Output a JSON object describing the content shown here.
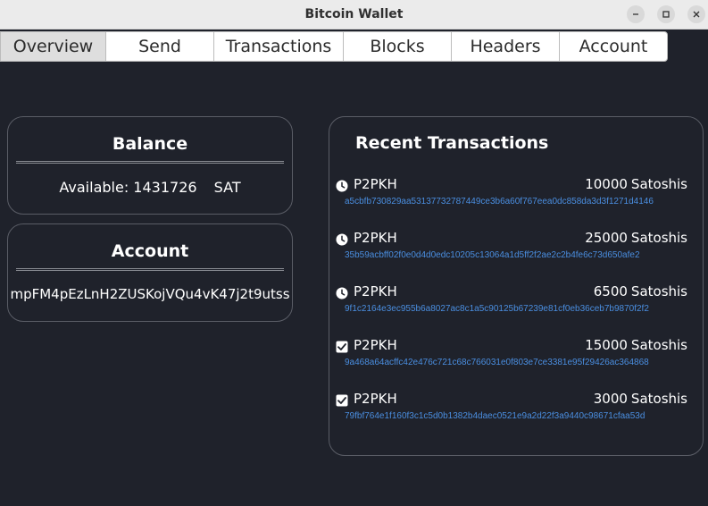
{
  "window": {
    "title": "Bitcoin Wallet"
  },
  "tabs": [
    {
      "label": "Overview",
      "active": true
    },
    {
      "label": "Send"
    },
    {
      "label": "Transactions"
    },
    {
      "label": "Blocks"
    },
    {
      "label": "Headers"
    },
    {
      "label": "Account"
    }
  ],
  "balance": {
    "title": "Balance",
    "available_label": "Available:",
    "amount": "1431726",
    "unit": "SAT"
  },
  "account": {
    "title": "Account",
    "address": "mpFM4pEzLnH2ZUSKojVQu4vK47j2t9utss"
  },
  "recent": {
    "title": "Recent Transactions",
    "transactions": [
      {
        "status_icon": "clock-icon",
        "type": "P2PKH",
        "amount": "10000",
        "unit": "Satoshis",
        "hash": "a5cbfb730829aa53137732787449ce3b6a60f767eea0dc858da3d3f1271d4146"
      },
      {
        "status_icon": "clock-icon",
        "type": "P2PKH",
        "amount": "25000",
        "unit": "Satoshis",
        "hash": "35b59acbff02f0e0d4d0edc10205c13064a1d5ff2f2ae2c2b4fe6c73d650afe2"
      },
      {
        "status_icon": "clock-icon",
        "type": "P2PKH",
        "amount": "6500",
        "unit": "Satoshis",
        "hash": "9f1c2164e3ec955b6a8027ac8c1a5c90125b67239e81cf0eb36ceb7b9870f2f2"
      },
      {
        "status_icon": "checkbox-checked-icon",
        "type": "P2PKH",
        "amount": "15000",
        "unit": "Satoshis",
        "hash": "9a468a64acffc42e476c721c68c766031e0f803e7ce3381e95f29426ac364868"
      },
      {
        "status_icon": "checkbox-checked-icon",
        "type": "P2PKH",
        "amount": "3000",
        "unit": "Satoshis",
        "hash": "79fbf764e1f160f3c1c5d0b1382b4daec0521e9a2d22f3a9440c98671cfaa53d"
      }
    ]
  },
  "colors": {
    "background": "#1f222b",
    "hash_link": "#4a8ee0",
    "tab_active": "#dedede"
  }
}
